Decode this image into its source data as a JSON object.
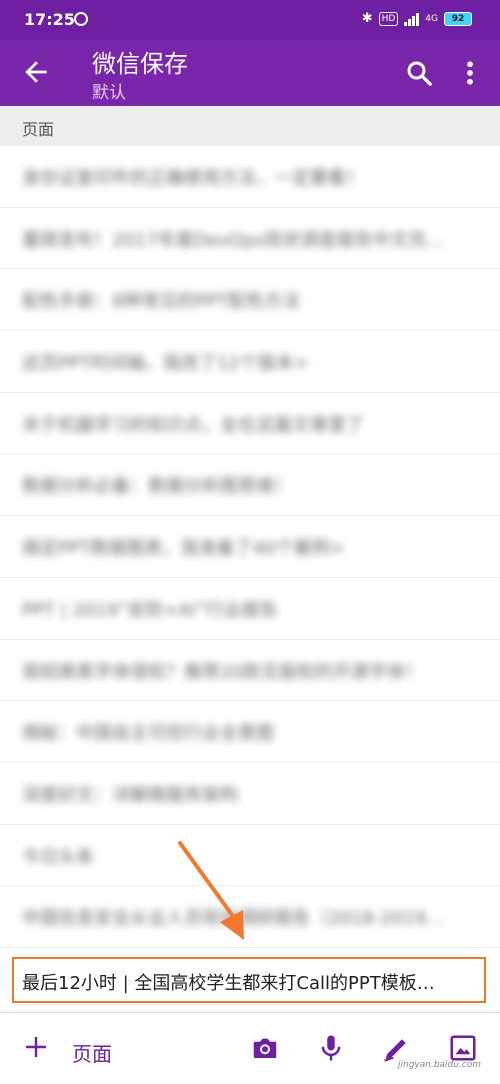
{
  "status_bar": {
    "time": "17:25",
    "network": "4G",
    "hd_label": "HD",
    "battery": "92",
    "icons": [
      "alarm-icon",
      "bluetooth-icon",
      "signal-icon",
      "battery-icon"
    ]
  },
  "app_bar": {
    "title": "微信保存",
    "subtitle": "默认",
    "icons": [
      "back-arrow-icon",
      "search-icon",
      "more-vert-icon"
    ]
  },
  "section": {
    "label": "页面"
  },
  "pages": [
    "身份证复印件的正确使用方法，一定要看！",
    "重磅发布！2017年度DevOps现状调查报告中文完…",
    "配色手册：8种常见的PPT配色方法",
    "这页PPT时间轴，我改了12个版本>",
    "关于机器学习的知识点，全在这篇文章里了",
    "数据分析必备：数据分析图思维！",
    "搞定PPT数据图表，我准备了40个案例>",
    "PPT | 2019“安防+AI”行业报告",
    "我轻换黑字体侵权？推荐20款无版权的开源字体！",
    "揭秘：中国自主可控行业全景图",
    "深度好文：详解微服务架构",
    "今日头条",
    "中国信息安全从业人员现状调研报告（2018-2019…"
  ],
  "highlighted_page": "最后12小时 | 全国高校学生都来打Call的PPT模板…",
  "bottom_bar": {
    "add_label": "页面",
    "icons": [
      "add-icon",
      "camera-icon",
      "microphone-icon",
      "pen-icon",
      "image-icon"
    ]
  },
  "annotation": {
    "arrow_color": "#ef7a2f"
  },
  "colors": {
    "status_bar": "#6f1fa2",
    "app_bar": "#7a26ab",
    "accent": "#6f1fa2"
  },
  "watermark": "jingyan.baidu.com"
}
